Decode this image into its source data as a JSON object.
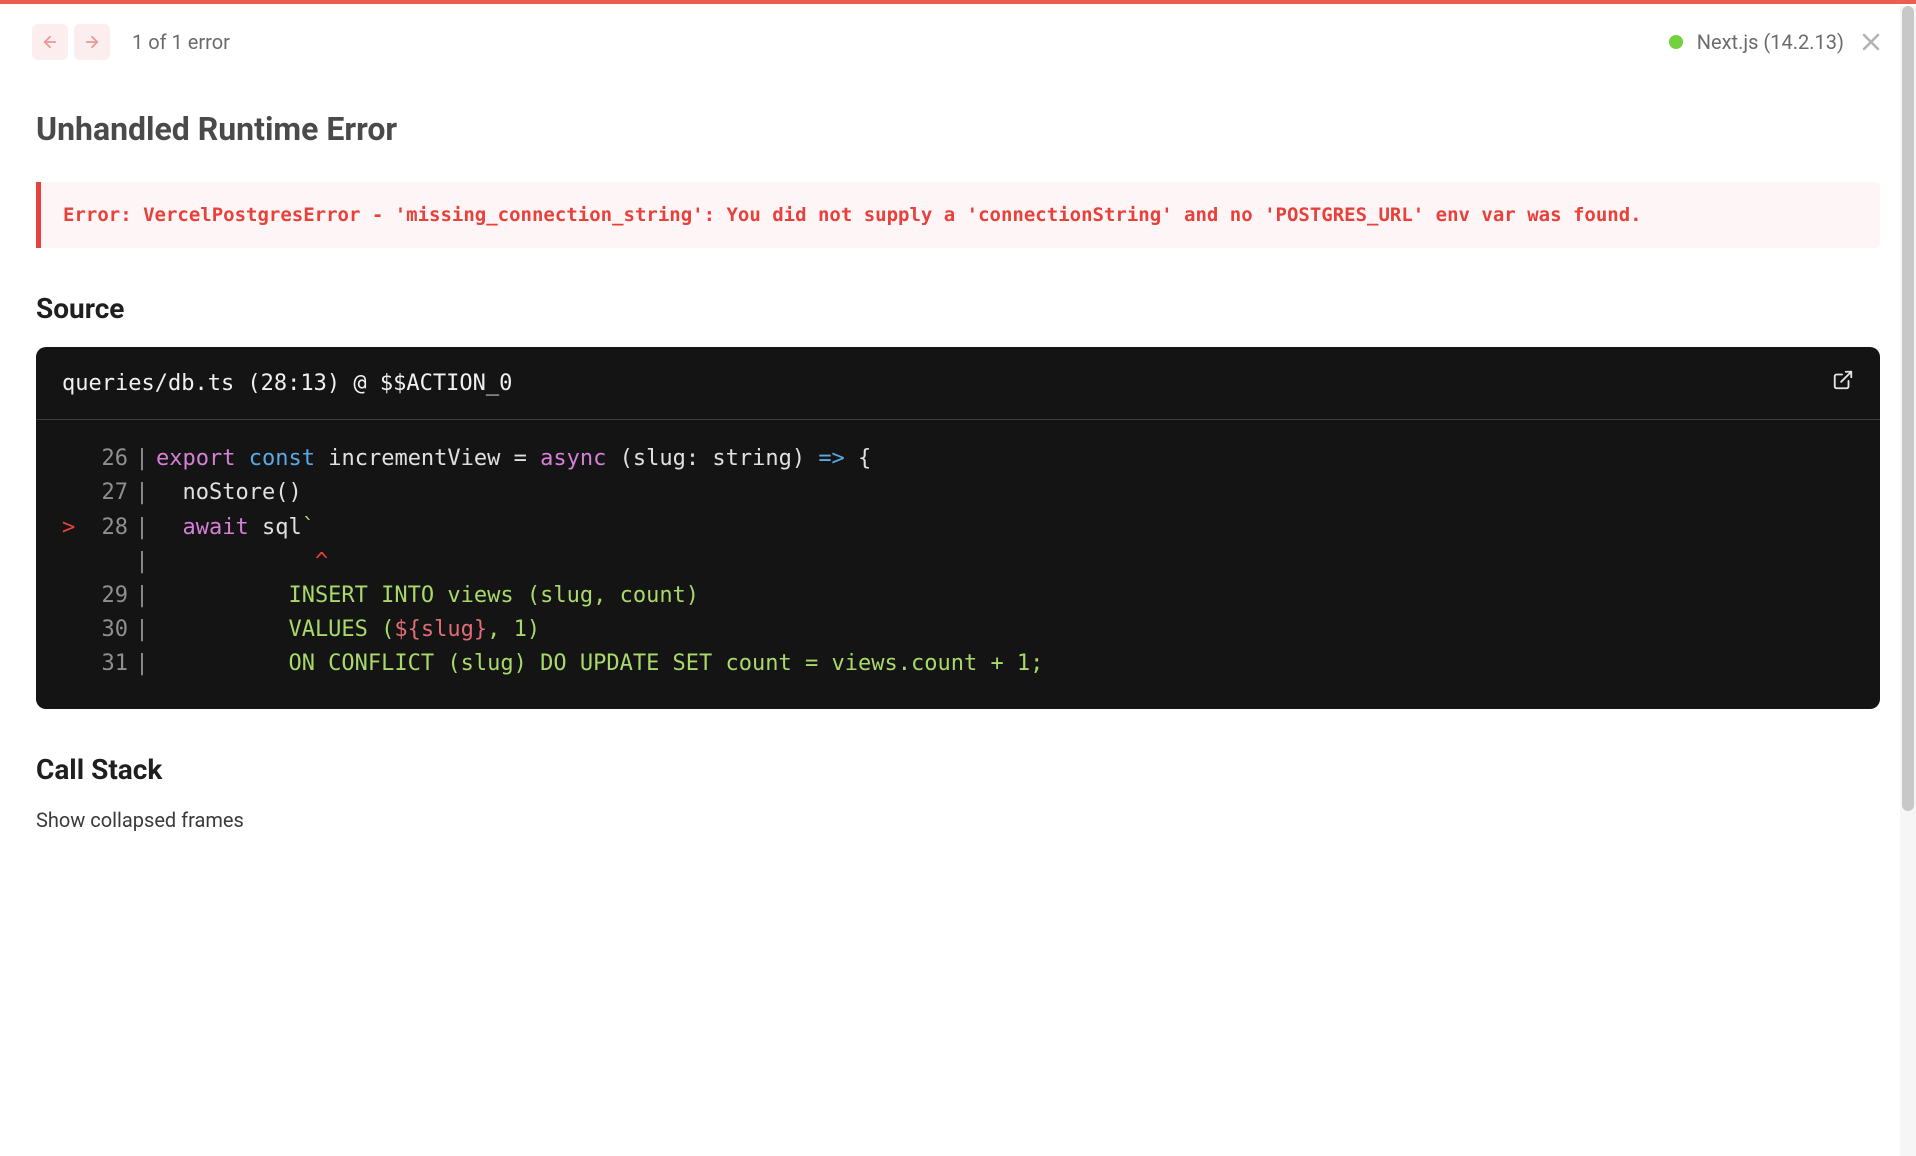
{
  "header": {
    "error_count": "1 of 1 error",
    "framework": "Next.js (14.2.13)"
  },
  "error": {
    "title": "Unhandled Runtime Error",
    "message": "Error: VercelPostgresError - 'missing_connection_string': You did not supply a 'connectionString' and no 'POSTGRES_URL' env var was found."
  },
  "source": {
    "heading": "Source",
    "location": "queries/db.ts (28:13) @ $$ACTION_0",
    "lines": {
      "l26_num": "26",
      "l26_kw1": "export",
      "l26_kw2": "const",
      "l26_ident": "incrementView",
      "l26_eq": " = ",
      "l26_async": "async",
      "l26_args": " (slug: string) ",
      "l26_arrow": "=>",
      "l26_brace": " {",
      "l27_num": "27",
      "l27_text": "  noStore()",
      "l28_mark": ">",
      "l28_num": "28",
      "l28_await": "  await",
      "l28_sql": " sql",
      "l28_tick": "`",
      "caret": "            ^",
      "l29_num": "29",
      "l29_text": "          INSERT INTO views (slug, count)",
      "l30_num": "30",
      "l30_text_a": "          VALUES (",
      "l30_interp": "${slug}",
      "l30_text_b": ", 1)",
      "l31_num": "31",
      "l31_text": "          ON CONFLICT (slug) DO UPDATE SET count = views.count + 1;"
    }
  },
  "callstack": {
    "heading": "Call Stack",
    "toggle": "Show collapsed frames"
  }
}
